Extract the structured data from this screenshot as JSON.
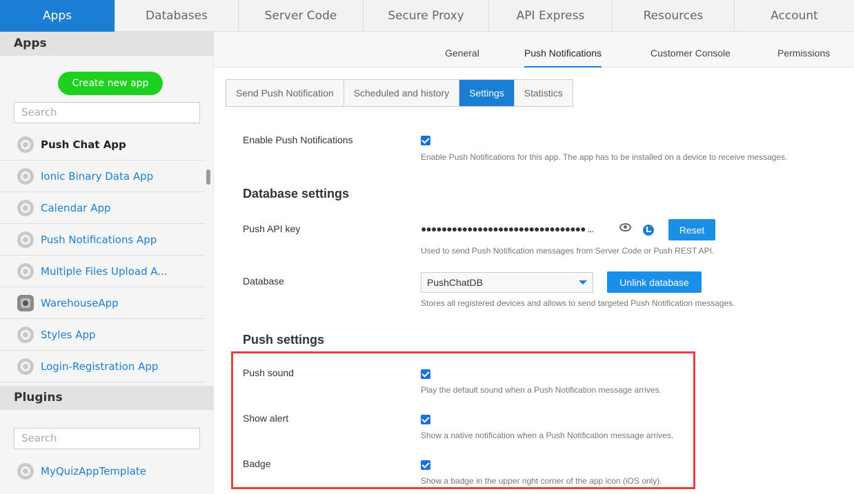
{
  "topnav": {
    "tabs": [
      "Apps",
      "Databases",
      "Server Code",
      "Secure Proxy",
      "API Express",
      "Resources",
      "Account"
    ],
    "active": "Apps"
  },
  "sidebar": {
    "apps_heading": "Apps",
    "create_button": "Create new app",
    "search_placeholder": "Search",
    "apps": [
      {
        "label": "Push Chat App",
        "icon": "ionic-icon",
        "current": true
      },
      {
        "label": "Ionic Binary Data App",
        "icon": "ionic-icon"
      },
      {
        "label": "Calendar App",
        "icon": "ionic-icon"
      },
      {
        "label": "Push Notifications App",
        "icon": "ionic-icon"
      },
      {
        "label": "Multiple Files Upload A...",
        "icon": "ionic-icon"
      },
      {
        "label": "WarehouseApp",
        "icon": "app-icon"
      },
      {
        "label": "Styles App",
        "icon": "ionic-icon"
      },
      {
        "label": "Login-Registration App",
        "icon": "ionic-icon"
      }
    ],
    "plugins_heading": "Plugins",
    "plugins_search_placeholder": "Search",
    "plugins": [
      {
        "label": "MyQuizAppTemplate",
        "icon": "ionic-icon"
      }
    ]
  },
  "subnav": {
    "tabs": [
      "General",
      "Push Notifications",
      "Customer Console",
      "Permissions"
    ],
    "active": "Push Notifications"
  },
  "push_tabs": {
    "tabs": [
      "Send Push Notification",
      "Scheduled and history",
      "Settings",
      "Statistics"
    ],
    "active": "Settings"
  },
  "settings": {
    "enable": {
      "label": "Enable Push Notifications",
      "checked": true,
      "help": "Enable Push Notifications for this app. The app has to be installed on a device to receive messages."
    },
    "database_section": "Database settings",
    "api_key": {
      "label": "Push API key",
      "value": "●●●●●●●●●●●●●●●●●●●●●●●●●●●●●●●● ...",
      "reset_label": "Reset",
      "help": "Used to send Push Notification messages from Server Code or Push REST API."
    },
    "database": {
      "label": "Database",
      "selected": "PushChatDB",
      "unlink_label": "Unlink database",
      "help": "Stores all registered devices and allows to send targeted Push Notification messages."
    },
    "push_section": "Push settings",
    "push_sound": {
      "label": "Push sound",
      "checked": true,
      "help": "Play the default sound when a Push Notification message arrives."
    },
    "show_alert": {
      "label": "Show alert",
      "checked": true,
      "help": "Show a native notification when a Push Notification message arrives."
    },
    "badge": {
      "label": "Badge",
      "checked": true,
      "help": "Show a badge in the upper right corner of the app icon (iOS only)."
    }
  },
  "colors": {
    "accent": "#1a7fd4",
    "create_button": "#1fd11f",
    "highlight_border": "#e84040"
  }
}
